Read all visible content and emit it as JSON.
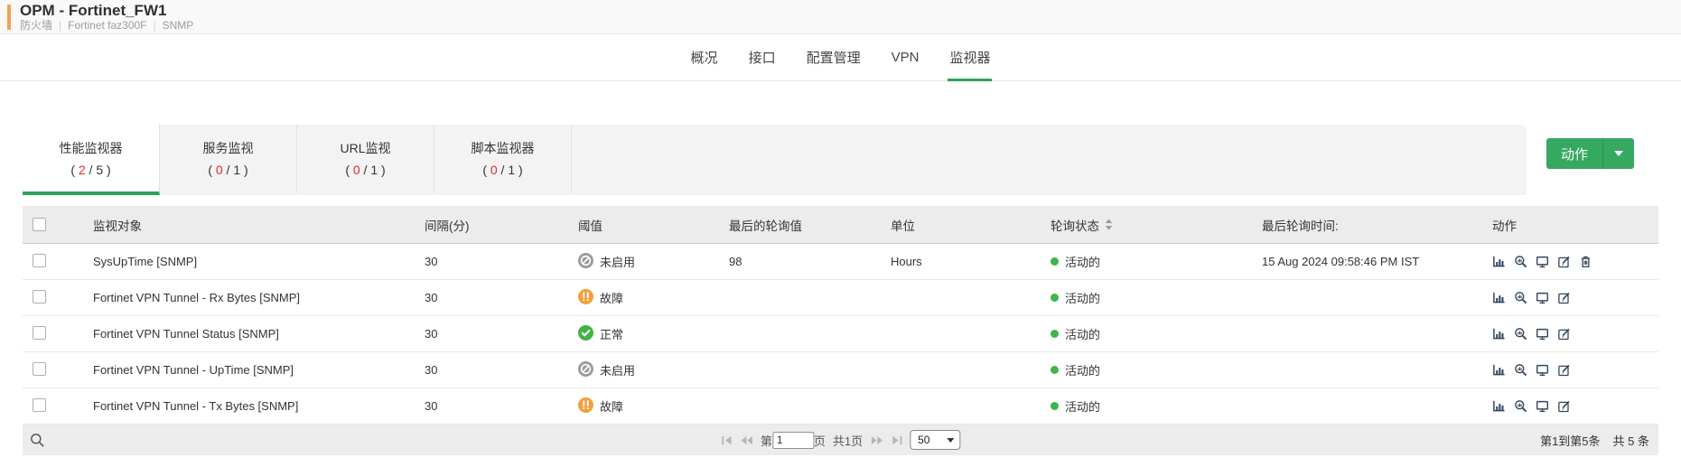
{
  "device_header": {
    "title": "OPM - Fortinet_FW1",
    "separator": "|",
    "meta": [
      "防火墙",
      "Fortinet faz300F",
      "SNMP"
    ]
  },
  "nav": {
    "tabs": [
      {
        "label": "概况"
      },
      {
        "label": "接口"
      },
      {
        "label": "配置管理"
      },
      {
        "label": "VPN"
      },
      {
        "label": "监视器"
      }
    ],
    "active": "监视器"
  },
  "monitor_tabs": [
    {
      "label": "性能监视器",
      "count_prefix": "( ",
      "count_current": "2",
      "count_suffix": " / 5 )",
      "active": true
    },
    {
      "label": "服务监视",
      "count_prefix": "( ",
      "count_current": "0",
      "count_suffix": " / 1 )",
      "active": false
    },
    {
      "label": "URL监视",
      "count_prefix": "( ",
      "count_current": "0",
      "count_suffix": " / 1 )",
      "active": false
    },
    {
      "label": "脚本监视器",
      "count_prefix": "( ",
      "count_current": "0",
      "count_suffix": " / 1 )",
      "active": false
    }
  ],
  "actions_button": {
    "label": "动作"
  },
  "table": {
    "columns": [
      "监视对象",
      "间隔(分)",
      "阈值",
      "最后的轮询值",
      "单位",
      "轮询状态",
      "最后轮询时间:",
      "动作"
    ],
    "rows": [
      {
        "name": "SysUpTime [SNMP]",
        "interval": "30",
        "threshold_state": "disabled",
        "threshold_label": "未启用",
        "last_value": "98",
        "unit": "Hours",
        "status": "活动的",
        "last_poll": "15 Aug 2024 09:58:46 PM IST"
      },
      {
        "name": "Fortinet VPN Tunnel - Rx Bytes [SNMP]",
        "interval": "30",
        "threshold_state": "trouble",
        "threshold_label": "故障",
        "last_value": "",
        "unit": "",
        "status": "活动的",
        "last_poll": ""
      },
      {
        "name": "Fortinet VPN Tunnel Status [SNMP]",
        "interval": "30",
        "threshold_state": "clear",
        "threshold_label": "正常",
        "last_value": "",
        "unit": "",
        "status": "活动的",
        "last_poll": ""
      },
      {
        "name": "Fortinet VPN Tunnel - UpTime [SNMP]",
        "interval": "30",
        "threshold_state": "disabled",
        "threshold_label": "未启用",
        "last_value": "",
        "unit": "",
        "status": "活动的",
        "last_poll": ""
      },
      {
        "name": "Fortinet VPN Tunnel - Tx Bytes [SNMP]",
        "interval": "30",
        "threshold_state": "trouble",
        "threshold_label": "故障",
        "last_value": "",
        "unit": "",
        "status": "活动的",
        "last_poll": ""
      }
    ]
  },
  "footer": {
    "page_prefix": "第",
    "page_value": "1",
    "page_suffix": "页",
    "total_pages": "共1页",
    "page_size": "50",
    "range": "第1到第5条",
    "total": "共 5 条"
  },
  "icons": {
    "row_actions": [
      "bar-chart",
      "search-report",
      "display",
      "edit",
      "delete"
    ],
    "threshold": {
      "disabled": "ban-circle",
      "trouble": "exclamation-circle",
      "clear": "check-circle"
    },
    "status_dot": "green-dot",
    "sort": "sort-arrows",
    "pager": [
      "first-page",
      "prev-page",
      "next-page",
      "last-page"
    ],
    "footer_search": "magnifier",
    "actions_caret": "chevron-down"
  },
  "colors": {
    "accent_green": "#36a961",
    "tab_underline_green": "#2aa55c",
    "count_red": "#e02a2a",
    "alert_orange": "#f0a03c",
    "ok_green": "#43b244",
    "disabled_gray": "#9b9b9b",
    "active_dot_green": "#3db54a",
    "brand_bar_orange": "#f2a253"
  }
}
